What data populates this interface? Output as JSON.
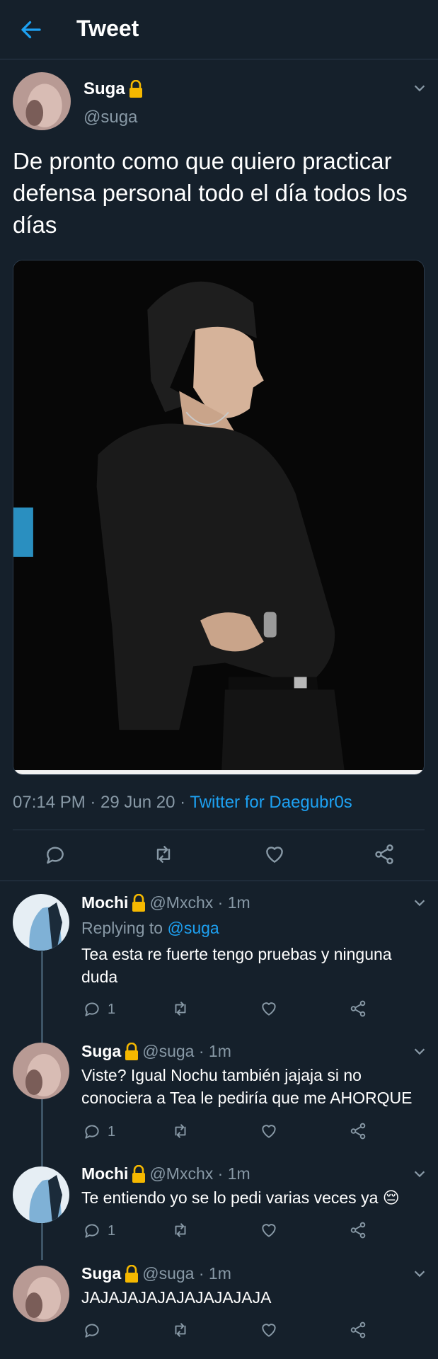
{
  "header": {
    "title": "Tweet",
    "back_icon": "arrow-left-icon"
  },
  "tweet": {
    "name": "Suga",
    "handle": "@suga",
    "text": "De pronto como que quiero practicar defensa personal todo el día todos los días",
    "timestamp": "07:14 PM · 29 Jun 20 · ",
    "source": "Twitter for Daegubr0s",
    "actions": [
      "reply-icon",
      "retweet-icon",
      "like-icon",
      "share-icon"
    ]
  },
  "replies": [
    {
      "name": "Mochi",
      "handle": "@Mxchx · 1m",
      "replying_prefix": "Replying to ",
      "replying_to": "@suga",
      "text": "Tea esta re fuerte tengo pruebas y ninguna duda",
      "reply_count": "1"
    },
    {
      "name": "Suga",
      "handle": "@suga · 1m",
      "text": "Viste? Igual Nochu también jajaja si no conociera a Tea le pediría que me AHORQUE",
      "reply_count": "1"
    },
    {
      "name": "Mochi",
      "handle": "@Mxchx · 1m",
      "text": "Te entiendo yo se lo pedi varias veces ya 😔",
      "reply_count": "1"
    },
    {
      "name": "Suga",
      "handle": "@suga · 1m",
      "text": "JAJAJAJAJAJAJAJAJAJA",
      "reply_count": ""
    }
  ],
  "colors": {
    "background": "#15202b",
    "accent": "#1da1f2",
    "muted": "#8899a6",
    "lock": "#f5b800"
  }
}
